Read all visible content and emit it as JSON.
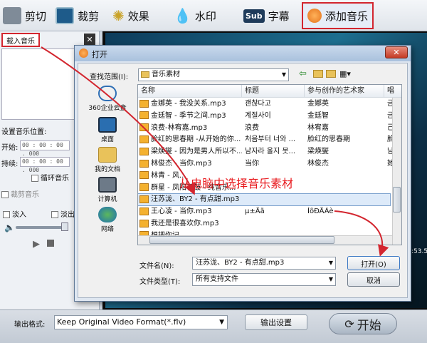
{
  "toolbar": {
    "items": [
      {
        "label": "剪切",
        "icon": "scissors-icon"
      },
      {
        "label": "裁剪",
        "icon": "crop-icon"
      },
      {
        "label": "效果",
        "icon": "effect-icon"
      },
      {
        "label": "水印",
        "icon": "watermark-icon"
      },
      {
        "label": "字幕",
        "icon": "subtitle-icon"
      },
      {
        "label": "添加音乐",
        "icon": "music-icon"
      }
    ],
    "subtitle_icon_text": "Sub"
  },
  "left_panel": {
    "load_music_tab": "载入音乐",
    "close_label": "✕",
    "position_label": "设置音乐位置:",
    "start_label": "开始:",
    "start_time": "00 : 00 : 00 . 000",
    "duration_label": "持续:",
    "duration_time": "00 : 00 : 00 . 000",
    "loop_label": "循环音乐",
    "crop_music_label": "裁剪音乐",
    "fade_in_label": "淡入",
    "fade_out_label": "淡出"
  },
  "preview": {
    "time_fragment": ":53.50"
  },
  "dialog": {
    "title": "打开",
    "close_label": "✕",
    "look_in_label": "查找范围(I):",
    "look_in_value": "音乐素材",
    "places": [
      {
        "label": "360企业云盘",
        "icon": "cloud-drive-icon"
      },
      {
        "label": "桌面",
        "icon": "desktop-icon"
      },
      {
        "label": "我的文档",
        "icon": "documents-icon"
      },
      {
        "label": "计算机",
        "icon": "computer-icon"
      },
      {
        "label": "网络",
        "icon": "network-icon"
      }
    ],
    "columns": [
      "名称",
      "标题",
      "参与创作的艺术家",
      "唱"
    ],
    "files": [
      {
        "name": "金娜英 - 我没关系.mp3",
        "title": "괜찮다고",
        "artist": "金娜英",
        "extra": "금"
      },
      {
        "name": "金廷智 - 季节之间.mp3",
        "title": "계절사이",
        "artist": "金廷智",
        "extra": "금"
      },
      {
        "name": "浪费-林宥嘉.mp3",
        "title": "浪费",
        "artist": "林宥嘉",
        "extra": "己"
      },
      {
        "name": "脸红的思春期 -从开始的你...",
        "title": "처음부터 너와 ...",
        "artist": "脸红的思春期",
        "extra": "脸"
      },
      {
        "name": "梁煐燮 - 因为是男人所以不...",
        "title": "남자라 울지 못...",
        "artist": "梁煐燮",
        "extra": "남"
      },
      {
        "name": "林俊杰 - 当你.mp3",
        "title": "当你",
        "artist": "林俊杰",
        "extra": "她"
      },
      {
        "name": "林青 - 风...",
        "title": "",
        "artist": "",
        "extra": ""
      },
      {
        "name": "群星 - 凤阳花鼓 - 纯音乐...",
        "title": "",
        "artist": "",
        "extra": ""
      },
      {
        "name": "汪苏泷、BY2 - 有点甜.mp3",
        "title": "",
        "artist": "",
        "extra": ""
      },
      {
        "name": "王心凌 - 当你.mp3",
        "title": "µ±Äã",
        "artist": "ÍõÐÄÁè",
        "extra": ""
      },
      {
        "name": "我还是很喜欢你.mp3",
        "title": "",
        "artist": "",
        "extra": ""
      },
      {
        "name": "想把你记...",
        "title": "",
        "artist": "",
        "extra": ""
      }
    ],
    "selected_index": 8,
    "filename_label": "文件名(N):",
    "filename_value": "汪苏泷、BY2 - 有点甜.mp3",
    "filetype_label": "文件类型(T):",
    "filetype_value": "所有支持文件",
    "open_button": "打开(O)",
    "cancel_button": "取消"
  },
  "annotation": {
    "text": "从电脑中选择音乐素材",
    "color": "#e8191d"
  },
  "bottom": {
    "format_label": "输出格式:",
    "format_value": "Keep Original Video Format(*.flv)",
    "settings_button": "输出设置",
    "start_button": "开始"
  },
  "colors": {
    "highlight": "#d3262f",
    "selection": "#ddeaf9"
  }
}
